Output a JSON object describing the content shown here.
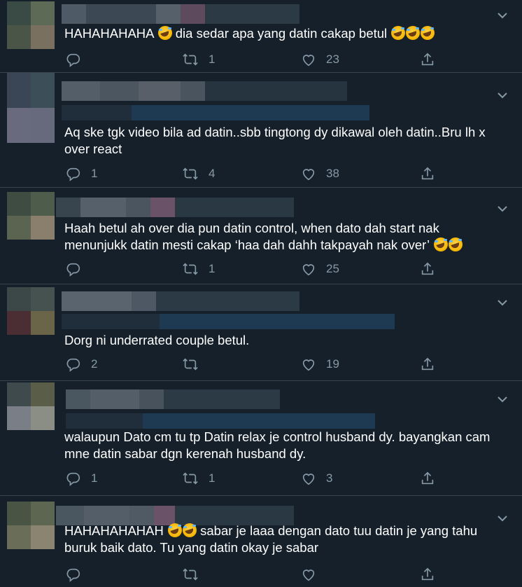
{
  "colors": {
    "background": "#15202b",
    "border": "#38444d",
    "icon": "#8899a6",
    "text": "#ffffff"
  },
  "tweets": [
    {
      "text": "HAHAHAHAHA",
      "text_after_emoji": " dia sedar apa yang datin cakap betul ",
      "emoji_before_count": 1,
      "emoji_after_count": 3,
      "replies": "",
      "retweets": "1",
      "likes": "23"
    },
    {
      "text": "Aq ske tgk video bila ad datin..sbb tingtong dy dikawal oleh datin..Bru lh x over react",
      "replies": "1",
      "retweets": "4",
      "likes": "38"
    },
    {
      "text": "Haah betul ah over dia pun datin control, when dato dah start nak menunjukk datin mesti cakap ‘haa dah dahh takpayah nak over’",
      "emoji_after_count": 2,
      "replies": "",
      "retweets": "1",
      "likes": "25"
    },
    {
      "text": "Dorg ni underrated couple betul.",
      "replies": "2",
      "retweets": "",
      "likes": "19"
    },
    {
      "text": "walaupun Dato cm tu tp Datin relax je control husband dy. bayangkan cam mne datin sabar dgn kerenah husband dy.",
      "replies": "1",
      "retweets": "1",
      "likes": "3"
    },
    {
      "text": "HAHAHAHAHAH",
      "text_after_emoji": " sabar je laaa dengan dato tuu datin je yang tahu buruk baik dato. Tu yang datin okay je sabar",
      "emoji_before_count": 2,
      "replies": "",
      "retweets": "",
      "likes": ""
    }
  ]
}
